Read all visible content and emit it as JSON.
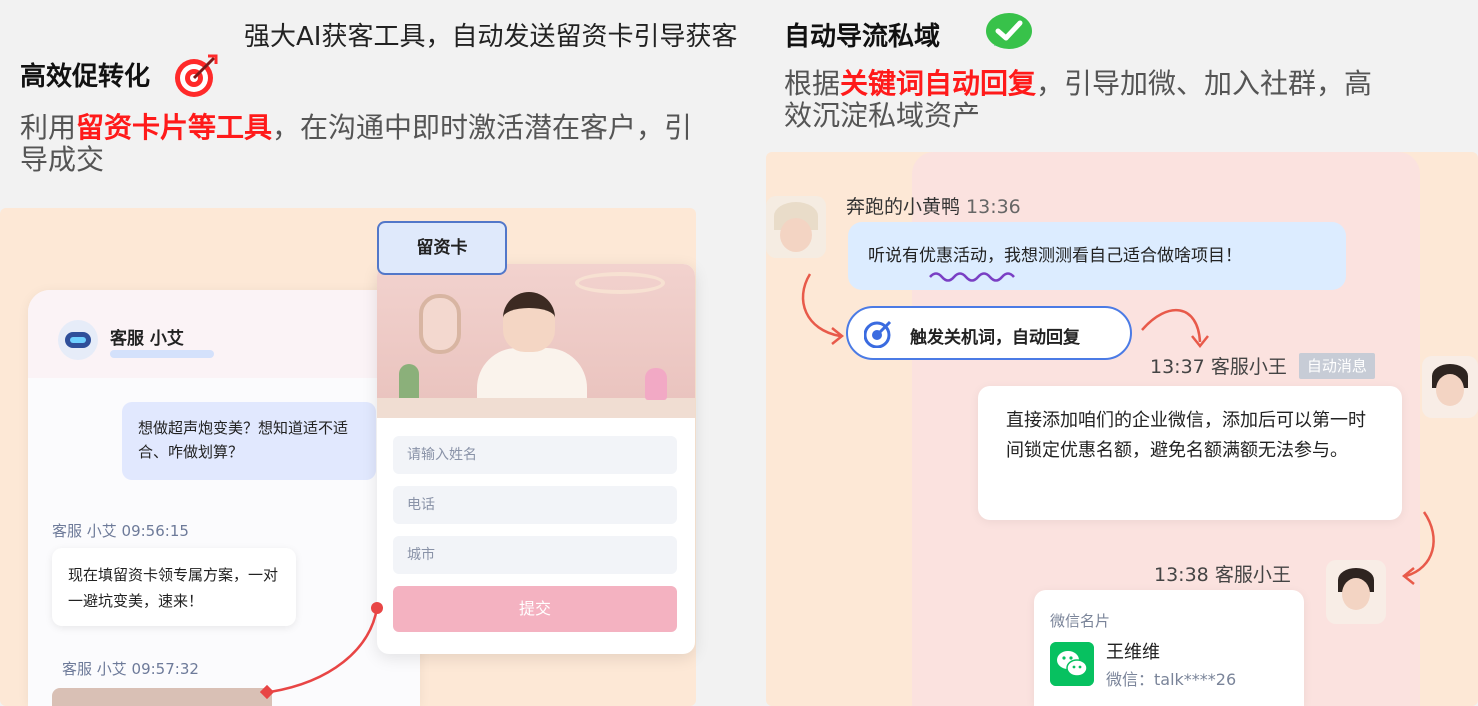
{
  "top_banner": "强大AI获客工具，自动发送留资卡引导获客",
  "left": {
    "title": "高效促转化",
    "desc_before": "利用",
    "desc_highlight": "留资卡片等工具",
    "desc_after": "，在沟通中即时激活潜在客户，引导成交",
    "chat": {
      "agent_name": "客服 小艾",
      "customer_message": "想做超声炮变美？想知道适不适合、咋做划算？",
      "timestamp_1": "客服 小艾 09:56:15",
      "agent_message": "现在填留资卡领专属方案，一对一避坑变美，速来！",
      "timestamp_2": "客服 小艾 09:57:32"
    },
    "form_card": {
      "tag": "留资卡",
      "name_placeholder": "请输入姓名",
      "phone_placeholder": "电话",
      "city_placeholder": "城市",
      "submit_label": "提交"
    }
  },
  "right": {
    "title": "自动导流私域",
    "desc_before": "根据",
    "desc_highlight": "关键词自动回复",
    "desc_after": "，引导加微、加入社群，高效沉淀私域资产",
    "user_name": "奔跑的小黄鸭",
    "user_time": "13:36",
    "user_message": "听说有优惠活动，我想测测看自己适合做啥项目！",
    "trigger_label": "触发关机词，自动回复",
    "reply_time": "13:37",
    "reply_agent": "客服小王",
    "auto_tag": "自动消息",
    "reply_message": "直接添加咱们的企业微信，添加后可以第一时间锁定优惠名额，避免名额满额无法参与。",
    "card_time": "13:38",
    "card_agent": "客服小王",
    "wechat_card": {
      "label": "微信名片",
      "name": "王维维",
      "id": "微信：talk****26"
    }
  },
  "colors": {
    "highlight": "#ff1a1a",
    "panel_bg": "#fde8d6",
    "accent_blue": "#4b7be5",
    "wechat_green": "#07c160"
  }
}
